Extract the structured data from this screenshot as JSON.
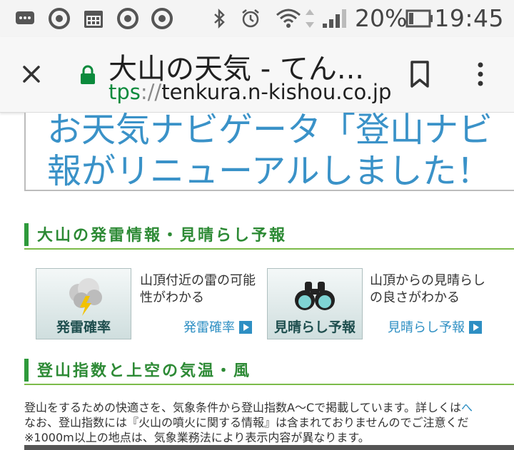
{
  "status_bar": {
    "battery_percent": "20%",
    "time": "19:45",
    "icons": [
      "message-icon",
      "chrome-icon",
      "calendar-icon",
      "chrome-icon",
      "chrome-icon",
      "bluetooth-icon",
      "alarm-icon",
      "wifi-icon",
      "signal-icon",
      "battery-icon"
    ]
  },
  "toolbar": {
    "title": "大山の天気 - てん...",
    "url_scheme": "tps",
    "url_sep": "://",
    "url_host": "tenkura.n-kishou.co.jp",
    "lock_color": "#0b8a3c"
  },
  "banner": {
    "line1": "お天気ナビゲータ「登山ナビ",
    "line2": "報がリニューアルしました！"
  },
  "section1": {
    "heading": "大山の発雷情報・見晴らし予報",
    "tiles": [
      {
        "label": "発雷確率",
        "desc1": "山頂付近の雷の可能",
        "desc2": "性がわかる",
        "link": "発雷確率"
      },
      {
        "label": "見晴らし予報",
        "desc1": "山頂からの見晴らし",
        "desc2": "の良さがわかる",
        "link": "見晴らし予報"
      }
    ]
  },
  "section2": {
    "heading": "登山指数と上空の気温・風",
    "line1": "登山をするための快適さを、気象条件から登山指数A〜Cで掲載しています。詳しくは",
    "line1_link": "へ",
    "line2": "なお、登山指数には『火山の噴火に関する情報』は含まれておりませんのでご注意くだ",
    "line3": "※1000m以上の地点は、気象業務法により表示内容が異なります。"
  },
  "colors": {
    "accent_green": "#2e9a3b",
    "link_blue": "#2e8fc3",
    "banner_blue": "#3a92c8"
  }
}
